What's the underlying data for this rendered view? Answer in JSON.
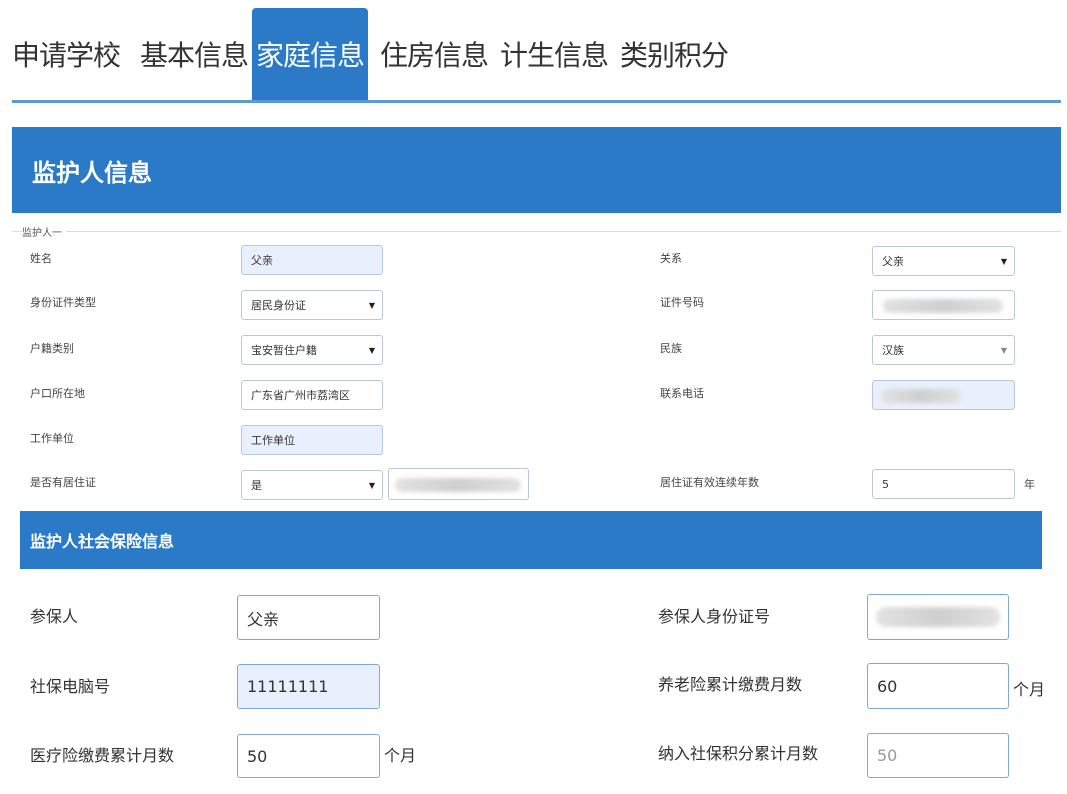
{
  "tabs": [
    {
      "label": "申请学校"
    },
    {
      "label": "基本信息"
    },
    {
      "label": "家庭信息"
    },
    {
      "label": "住房信息"
    },
    {
      "label": "计生信息"
    },
    {
      "label": "类别积分"
    }
  ],
  "guardian_section": {
    "title": "监护人信息",
    "legend": "监护人一",
    "name": {
      "label": "姓名",
      "value": "父亲"
    },
    "relation": {
      "label": "关系",
      "value": "父亲"
    },
    "id_type": {
      "label": "身份证件类型",
      "value": "居民身份证"
    },
    "id_number": {
      "label": "证件号码",
      "value": ""
    },
    "hukou_type": {
      "label": "户籍类别",
      "value": "宝安暂住户籍"
    },
    "ethnicity": {
      "label": "民族",
      "value": "汉族"
    },
    "hukou_location": {
      "label": "户口所在地",
      "value": "广东省广州市荔湾区"
    },
    "phone": {
      "label": "联系电话",
      "value": ""
    },
    "work_unit": {
      "label": "工作单位",
      "value": "工作单位"
    },
    "has_residence_permit": {
      "label": "是否有居住证",
      "value": "是"
    },
    "permit_years": {
      "label": "居住证有效连续年数",
      "value": "5",
      "unit": "年"
    }
  },
  "social_section": {
    "title": "监护人社会保险信息",
    "insured_person": {
      "label": "参保人",
      "value": "父亲"
    },
    "insured_id": {
      "label": "参保人身份证号",
      "value": ""
    },
    "si_number": {
      "label": "社保电脑号",
      "value": "11111111"
    },
    "pension_months": {
      "label": "养老险累计缴费月数",
      "value": "60",
      "unit": "个月"
    },
    "medical_months": {
      "label": "医疗险缴费累计月数",
      "value": "50",
      "unit": "个月"
    },
    "points_months": {
      "label": "纳入社保积分累计月数",
      "value": "50"
    }
  }
}
